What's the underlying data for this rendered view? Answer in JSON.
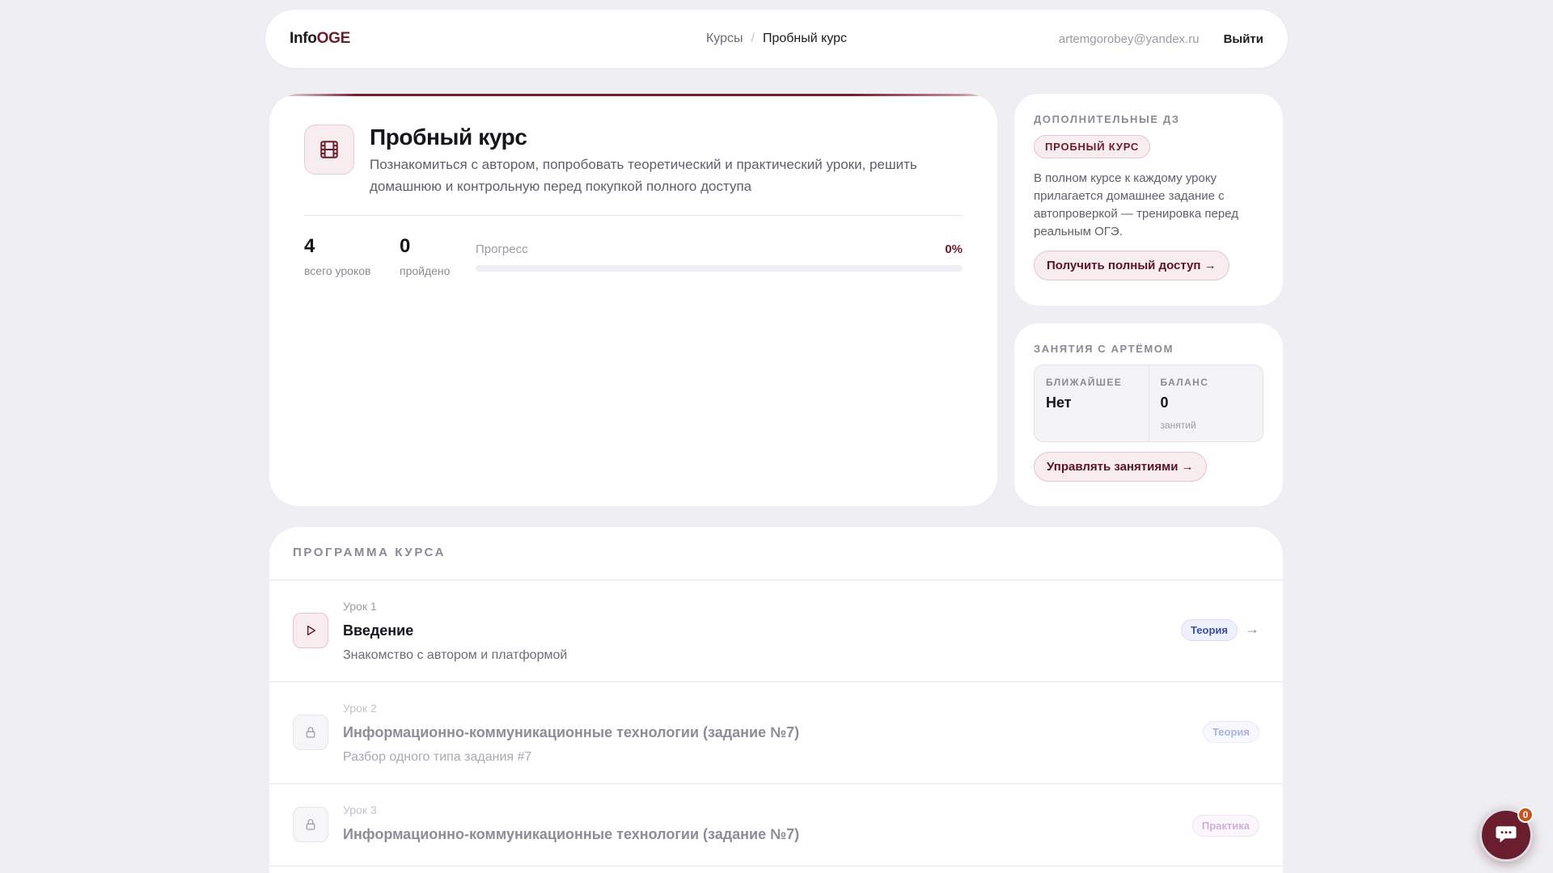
{
  "header": {
    "logo_main": "Info",
    "logo_accent": "OGE",
    "breadcrumb": {
      "parent": "Курсы",
      "separator": "/",
      "current": "Пробный курс"
    },
    "user_email": "artemgorobey@yandex.ru",
    "logout_label": "Выйти"
  },
  "course": {
    "icon": "film-icon",
    "title": "Пробный курс",
    "description": "Познакомиться с автором, попробовать теоретический и практический уроки, решить домашнюю и контрольную перед покупкой полного доступа",
    "stats": {
      "total_value": "4",
      "total_label": "всего уроков",
      "done_value": "0",
      "done_label": "пройдено"
    },
    "progress": {
      "label": "Прогресс",
      "percent_text": "0%",
      "fraction": 0
    }
  },
  "extra_hw": {
    "label": "ДОПОЛНИТЕЛЬНЫЕ ДЗ",
    "badge": "ПРОБНЫЙ КУРС",
    "text": "В полном курсе к каждому уроку прилагается домашнее задание с автопроверкой — тренировка перед реальным ОГЭ.",
    "button": "Получить полный доступ →"
  },
  "sessions": {
    "label": "ЗАНЯТИЯ С АРТЁМОМ",
    "next_label": "БЛИЖАЙШЕЕ",
    "next_value": "Нет",
    "balance_label": "БАЛАНС",
    "balance_value": "0",
    "balance_unit": "занятий",
    "button": "Управлять занятиями →"
  },
  "program": {
    "title": "ПРОГРАММА КУРСА",
    "lessons": [
      {
        "num": "Урок 1",
        "title": "Введение",
        "subtitle": "Знакомство с автором и платформой",
        "tag": "Теория",
        "state": "open",
        "icon": "play-icon",
        "arrow": "→"
      },
      {
        "num": "Урок 2",
        "title": "Информационно-коммуникационные технологии (задание №7)",
        "subtitle": "Разбор одного типа задания #7",
        "tag": "Теория",
        "state": "locked",
        "icon": "lock-icon"
      },
      {
        "num": "Урок 3",
        "title": "Информационно-коммуникационные технологии (задание №7)",
        "subtitle": "",
        "tag": "Практика",
        "state": "locked",
        "icon": "lock-icon"
      }
    ]
  },
  "chat": {
    "badge": "0",
    "icon": "chat-icon"
  },
  "colors": {
    "accent": "#6e1c2b",
    "background": "#efeff3",
    "theory_tag": "#3b4fa3",
    "chat_badge": "#c8541f"
  }
}
